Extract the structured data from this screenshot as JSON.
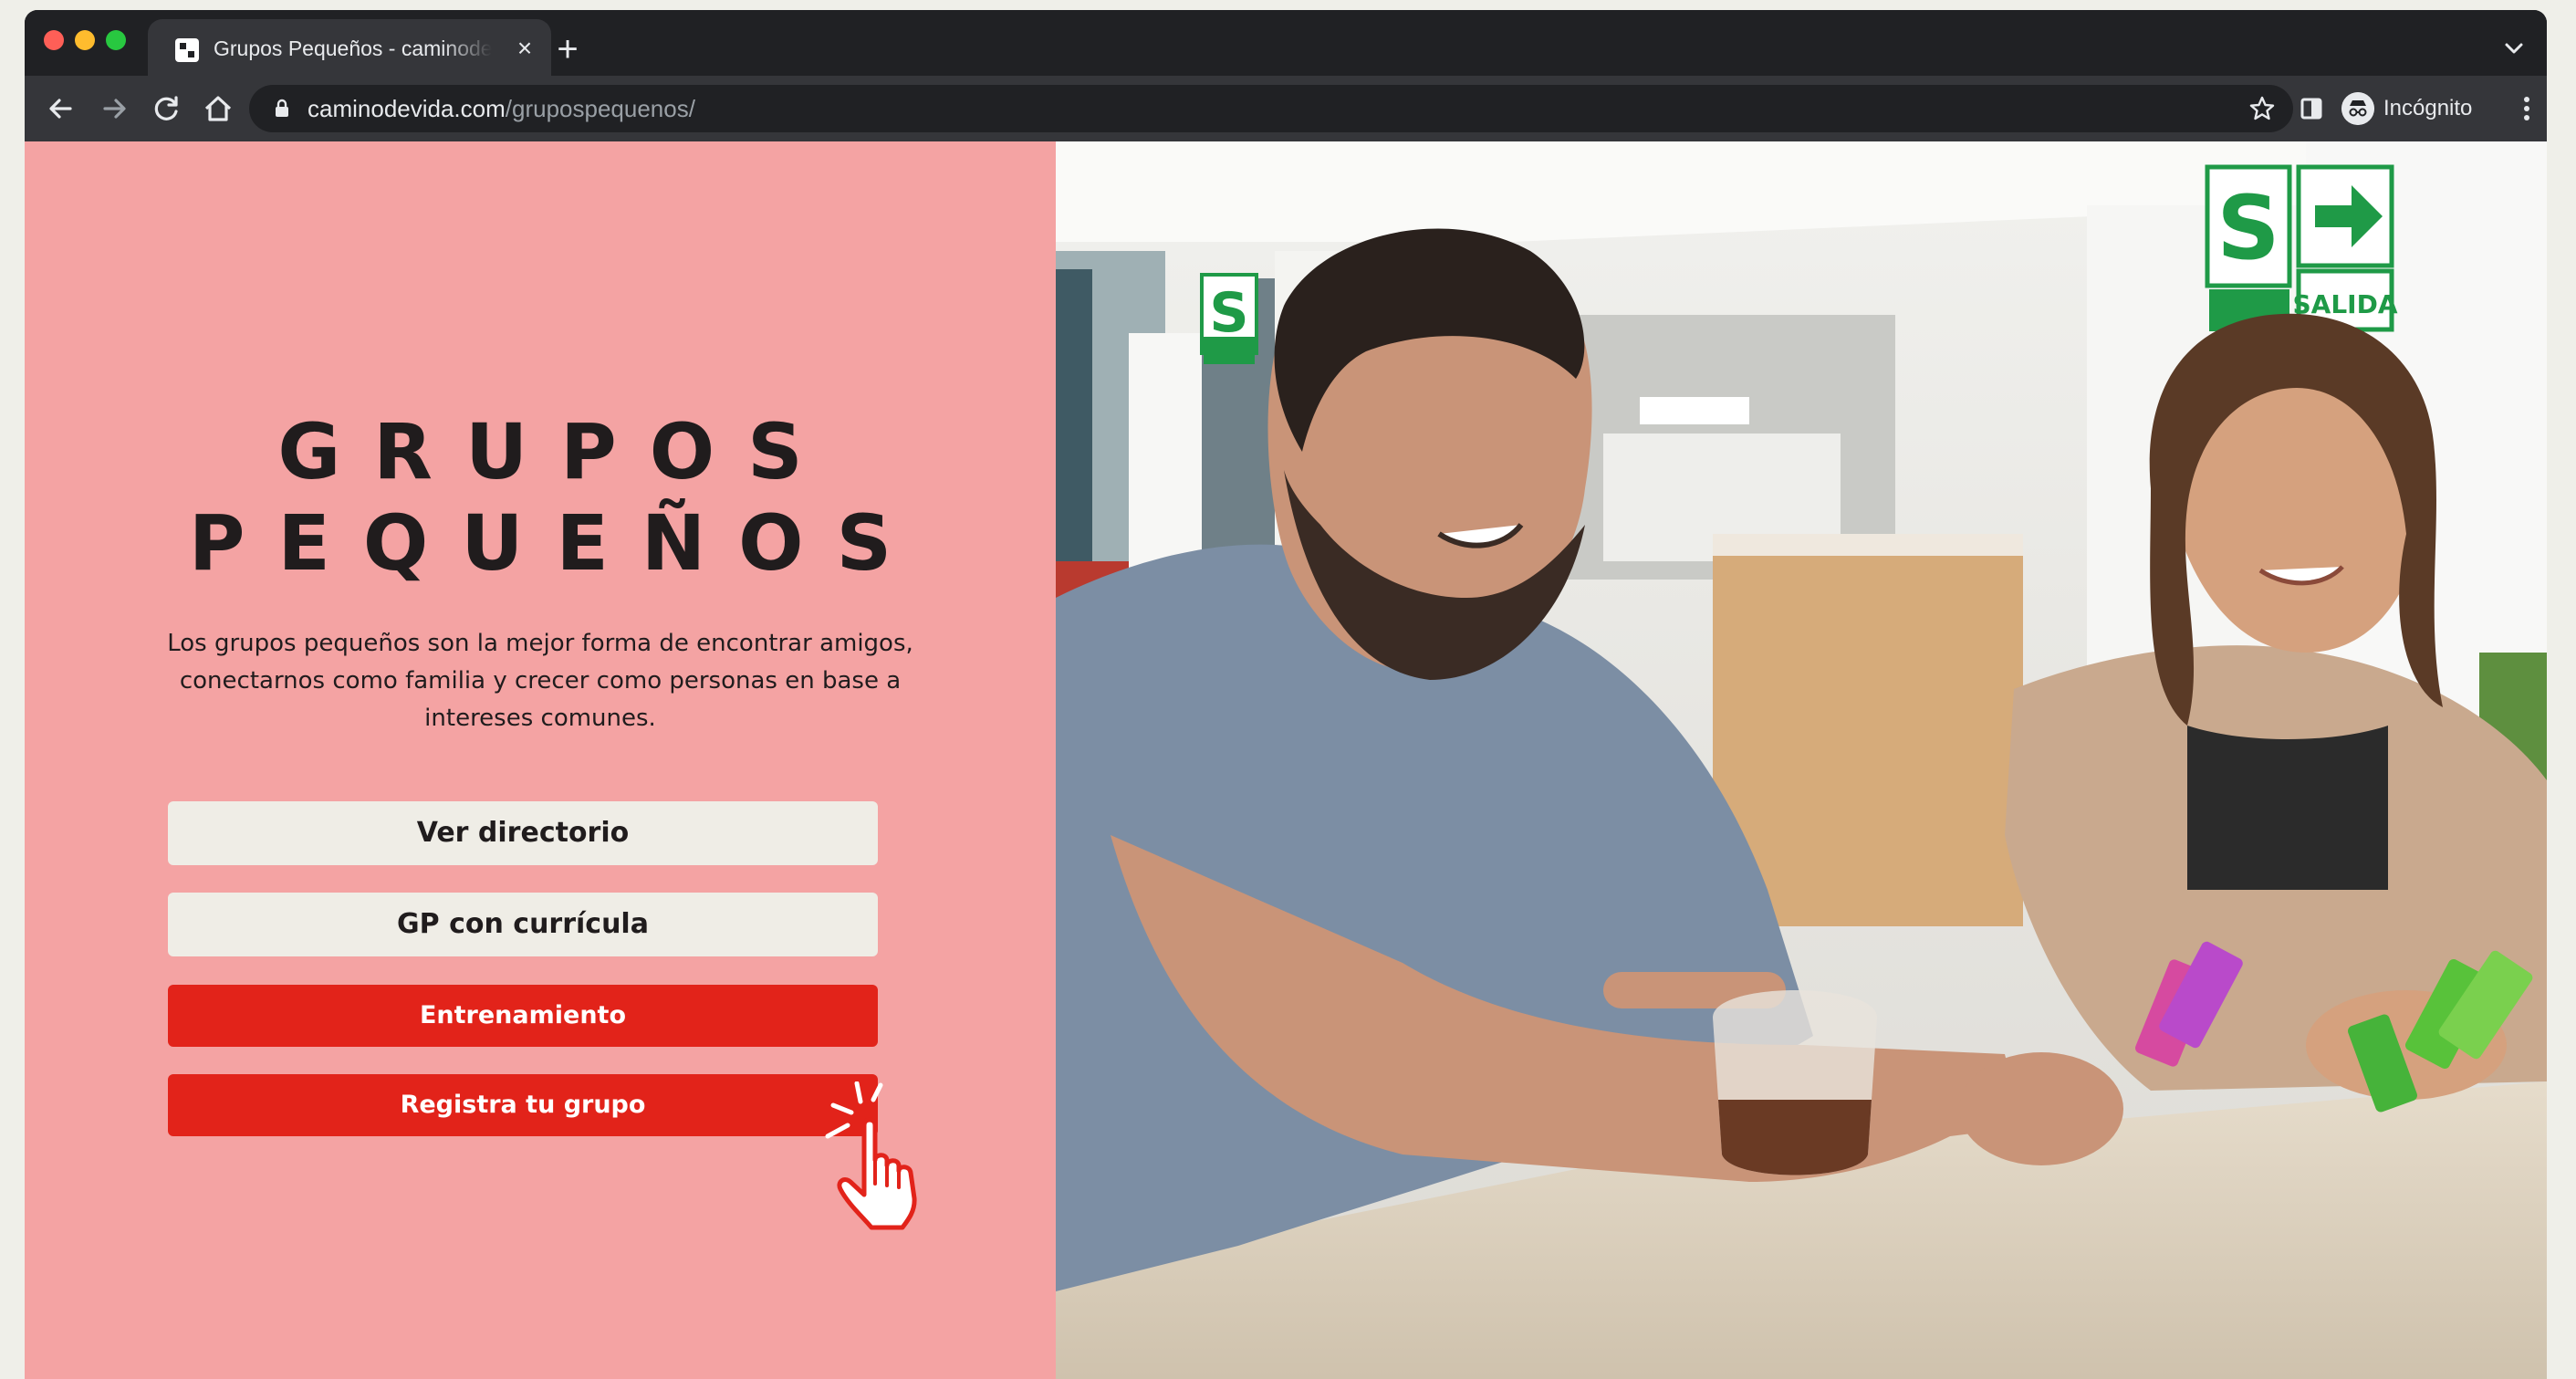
{
  "browser": {
    "tab_title": "Grupos Pequeños - caminodevida",
    "tab_close": "×",
    "new_tab": "+",
    "url_domain": "caminodevida.com",
    "url_path": "/grupospequenos/",
    "profile_label": "Incógnito"
  },
  "hero": {
    "title_line1": "GRUPOS",
    "title_line2": "PEQUEÑOS",
    "description": "Los grupos pequeños son la mejor forma de encontrar amigos, conectarnos como familia y crecer como personas en base a intereses comunes."
  },
  "buttons": {
    "directory": "Ver directorio",
    "curriculum": "GP con currícula",
    "training": "Entrenamiento",
    "register": "Registra tu grupo"
  },
  "photo_signs": {
    "left_sign": "S",
    "right_sign": "S",
    "exit_label": "SALIDA"
  },
  "colors": {
    "left_panel_bg": "#f4a3a3",
    "light_button_bg": "#efede6",
    "accent_red": "#e2231a",
    "title_text": "#201c1d",
    "sign_green": "#1f9a47"
  },
  "icons": {
    "back": "arrow-left-icon",
    "forward": "arrow-right-icon",
    "reload": "reload-icon",
    "home": "home-icon",
    "lock": "lock-icon",
    "bookmark": "star-icon",
    "side_panel": "side-panel-icon",
    "profile": "incognito-icon",
    "menu": "kebab-menu-icon",
    "cursor": "hand-pointer-icon"
  }
}
